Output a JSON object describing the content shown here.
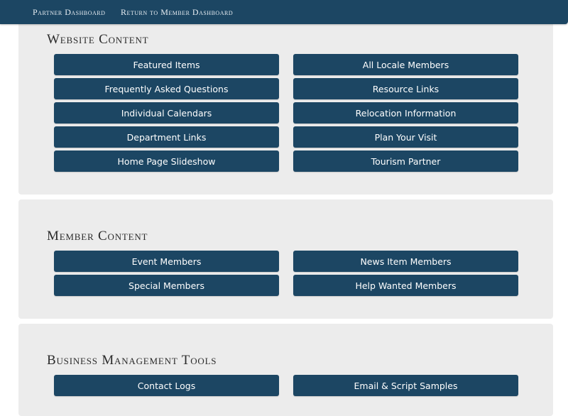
{
  "topnav": {
    "items": [
      {
        "label": "Partner Dashboard"
      },
      {
        "label": "Return to Member Dashboard"
      }
    ]
  },
  "sections": [
    {
      "title": "Website Content",
      "buttons": [
        {
          "label": "Featured Items"
        },
        {
          "label": "All Locale Members"
        },
        {
          "label": "Frequently Asked Questions"
        },
        {
          "label": "Resource Links"
        },
        {
          "label": "Individual Calendars"
        },
        {
          "label": "Relocation Information"
        },
        {
          "label": "Department Links"
        },
        {
          "label": "Plan Your Visit"
        },
        {
          "label": "Home Page Slideshow"
        },
        {
          "label": "Tourism Partner"
        }
      ]
    },
    {
      "title": "Member Content",
      "buttons": [
        {
          "label": "Event Members"
        },
        {
          "label": "News Item Members"
        },
        {
          "label": "Special Members"
        },
        {
          "label": "Help Wanted Members"
        }
      ]
    },
    {
      "title": "Business Management Tools",
      "buttons": [
        {
          "label": "Contact Logs"
        },
        {
          "label": "Email & Script Samples"
        }
      ]
    }
  ],
  "colors": {
    "nav_bg": "#1c4663",
    "button_bg": "#1c4663",
    "panel_bg": "#ececec"
  }
}
